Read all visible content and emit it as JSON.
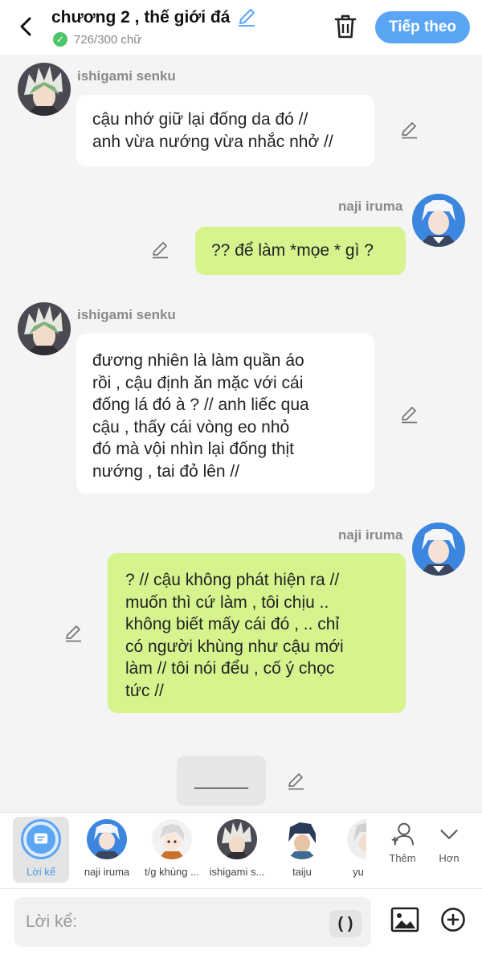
{
  "header": {
    "title": "chương 2 , thế giới đá",
    "word_count": "726/300 chữ",
    "next_label": "Tiếp theo"
  },
  "messages": [
    {
      "sender": "ishigami senku",
      "side": "left",
      "lines": [
        "cậu nhớ giữ lại đống da đó //",
        "anh vừa nướng vừa nhắc nhở //"
      ]
    },
    {
      "sender": "naji iruma",
      "side": "right",
      "lines": [
        "?? để làm *mọe * gì ?"
      ]
    },
    {
      "sender": "ishigami senku",
      "side": "left",
      "lines": [
        "đương nhiên là làm quần áo",
        "rồi , cậu định ăn mặc với cái",
        "đống lá đó à ? // anh liếc qua",
        "cậu , thấy cái vòng eo nhỏ",
        "đó mà vội nhìn lại đống thịt",
        "nướng , tai đỏ lên //"
      ]
    },
    {
      "sender": "naji iruma",
      "side": "right",
      "lines": [
        "? // cậu không phát hiện ra //",
        "muốn thì cứ làm , tôi chịu ..",
        "không biết mấy cái đó , .. chỉ",
        "có người khùng như cậu mới",
        "làm // tôi nói đểu , cố ý chọc",
        "tức //"
      ]
    }
  ],
  "narration": "______",
  "characters": [
    {
      "label": "Lời kể"
    },
    {
      "label": "naji iruma"
    },
    {
      "label": "t/g khùng ..."
    },
    {
      "label": "ishigami s..."
    },
    {
      "label": "taiju"
    },
    {
      "label": "yu"
    }
  ],
  "tools": {
    "more_label": "Thêm",
    "less_label": "Hơn"
  },
  "input": {
    "placeholder": "Lời kể:",
    "paren_label": "( )"
  },
  "colors": {
    "accent": "#5aa6f5",
    "right_bubble": "#d6f48e",
    "left_bubble": "#ffffff",
    "background": "#f4f4f4",
    "check": "#4cc66a"
  }
}
